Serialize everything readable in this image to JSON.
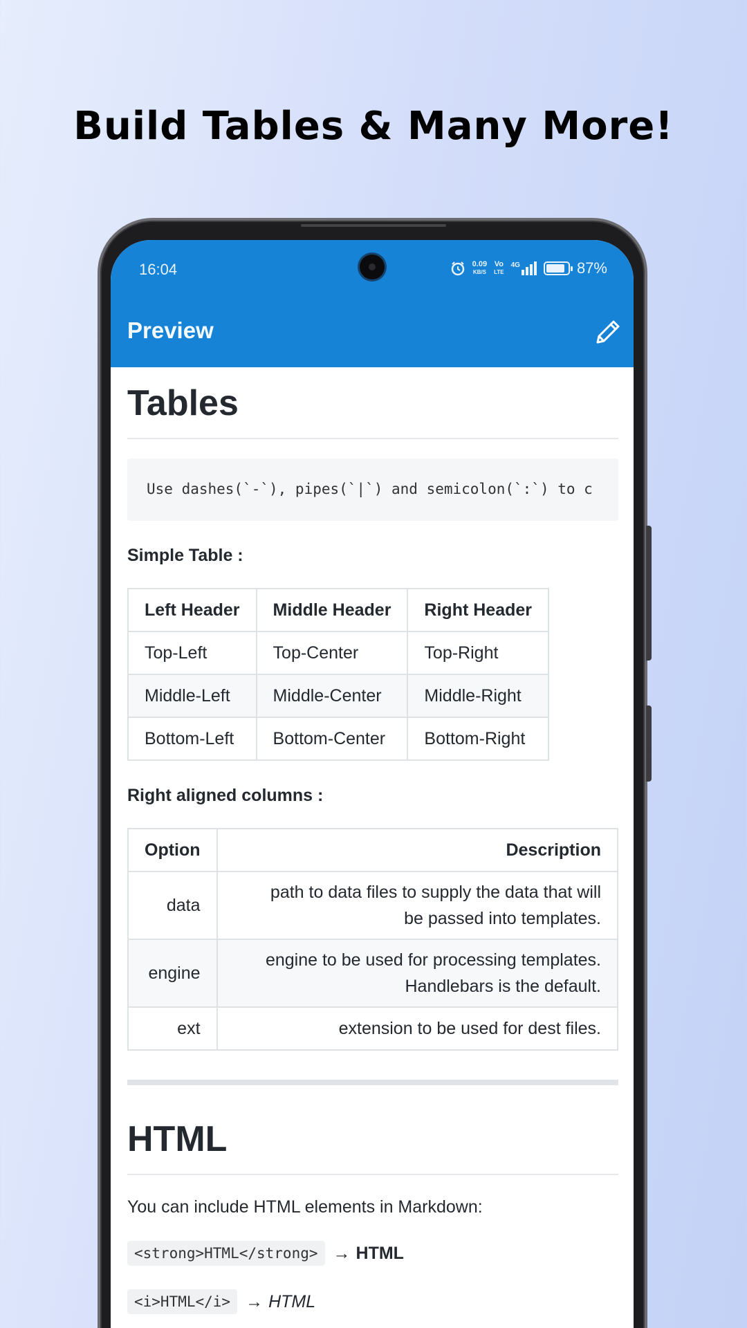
{
  "promo": {
    "headline": "Build Tables & Many More!"
  },
  "status_bar": {
    "time": "16:04",
    "net_speed_value": "0.09",
    "net_speed_unit": "KB/S",
    "volte_top": "Vo",
    "volte_bottom": "LTE",
    "network": "4G",
    "battery": "87%",
    "battery_level": 0.87
  },
  "appbar": {
    "title": "Preview",
    "edit_icon": "pencil-icon",
    "color": "#1683d6"
  },
  "doc": {
    "tables_heading": "Tables",
    "code_line": "Use dashes(`-`), pipes(`|`) and semicolon(`:`) to c",
    "simple_label": "Simple Table :",
    "simple_table": {
      "headers": [
        "Left Header",
        "Middle Header",
        "Right Header"
      ],
      "rows": [
        [
          "Top-Left",
          "Top-Center",
          "Top-Right"
        ],
        [
          "Middle-Left",
          "Middle-Center",
          "Middle-Right"
        ],
        [
          "Bottom-Left",
          "Bottom-Center",
          "Bottom-Right"
        ]
      ]
    },
    "right_label": "Right aligned columns :",
    "right_table": {
      "headers": [
        "Option",
        "Description"
      ],
      "rows": [
        {
          "option": "data",
          "desc_line1": "path to data files to supply the data that will",
          "desc_line2": "be passed into templates."
        },
        {
          "option": "engine",
          "desc_line1": "engine to be used for processing templates.",
          "desc_line2": "Handlebars is the default."
        },
        {
          "option": "ext",
          "desc_line1": "extension to be used for dest files.",
          "desc_line2": ""
        }
      ]
    },
    "html_heading": "HTML",
    "html_intro": "You can include HTML elements in Markdown:",
    "html_examples": [
      {
        "code": "<strong>HTML</strong>",
        "arrow": "→",
        "result": "HTML"
      },
      {
        "code": "<i>HTML</i>",
        "arrow": "→",
        "result": "HTML"
      }
    ]
  }
}
